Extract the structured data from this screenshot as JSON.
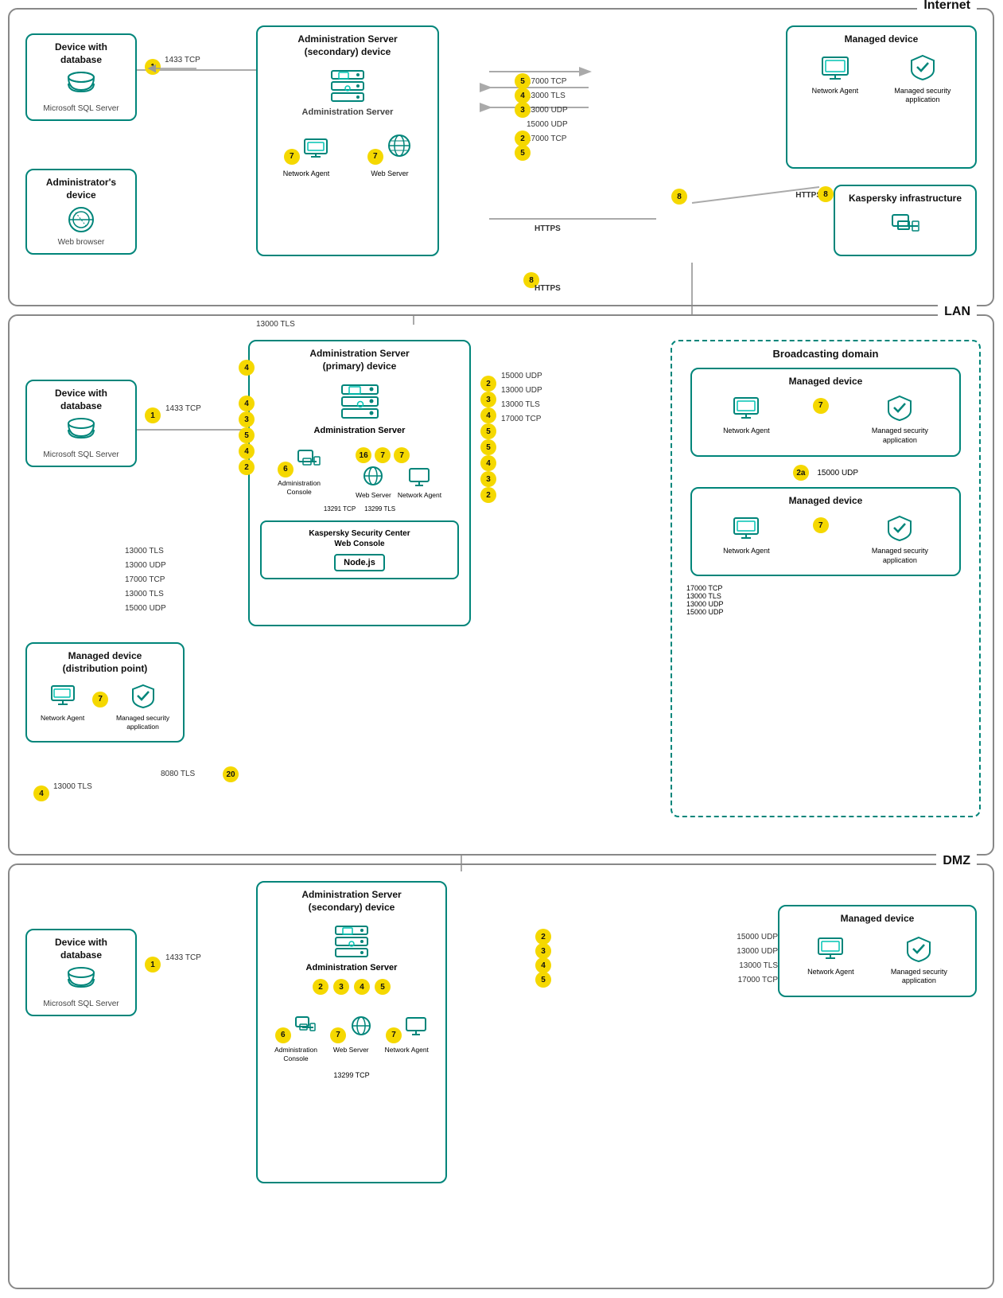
{
  "zones": {
    "internet": {
      "label": "Internet"
    },
    "lan": {
      "label": "LAN"
    },
    "dmz": {
      "label": "DMZ"
    }
  },
  "internet": {
    "db_device": {
      "title": "Device with database",
      "subtitle": "Microsoft SQL Server"
    },
    "admin_server_secondary": {
      "title": "Administration Server\n(secondary) device",
      "server_label": "Administration Server"
    },
    "managed_device": {
      "title": "Managed device"
    },
    "administrator_device": {
      "title": "Administrator's device",
      "subtitle": "Web browser"
    },
    "kaspersky_infra": {
      "title": "Kaspersky infrastructure"
    },
    "network_agent_label": "Network Agent",
    "web_server_label": "Web Server",
    "managed_security_label": "Managed security\napplication",
    "ports": {
      "p1": "1433 TCP",
      "p2": "13000 UDP\n15000 UDP\n17000 TCP",
      "p3": "13000 UDP",
      "p4": "13000 TLS",
      "p5a": "17000 TCP",
      "p5b": "5",
      "https1": "HTTPS",
      "https2": "HTTPS",
      "https3": "HTTPS"
    }
  },
  "lan": {
    "title": "LAN",
    "admin_primary": {
      "title": "Administration Server\n(primary) device",
      "server_label": "Administration Server"
    },
    "db_device": {
      "title": "Device with database",
      "subtitle": "Microsoft SQL Server"
    },
    "broadcasting_domain": {
      "title": "Broadcasting domain"
    },
    "distribution_point": {
      "title": "Managed device\n(distribution point)"
    },
    "ksc_web_console": {
      "title": "Kaspersky Security Center\nWeb Console",
      "nodejs": "Node.js"
    },
    "network_agent_label": "Network Agent",
    "web_server_label": "Web Server",
    "admin_console_label": "Administration\nConsole"
  },
  "dmz": {
    "title": "DMZ",
    "db_device": {
      "title": "Device with database",
      "subtitle": "Microsoft SQL Server"
    },
    "admin_server_secondary": {
      "title": "Administration Server\n(secondary) device",
      "server_label": "Administration Server"
    },
    "managed_device": {
      "title": "Managed device"
    },
    "network_agent_label": "Network Agent",
    "web_server_label": "Web Server",
    "admin_console_label": "Administration\nConsole",
    "managed_security_label": "Managed security\napplication"
  }
}
